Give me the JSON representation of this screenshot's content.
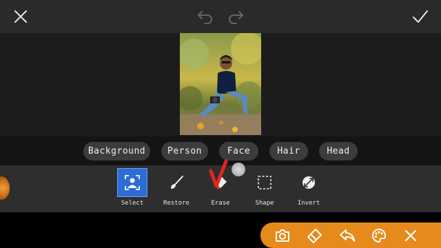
{
  "topbar": {
    "close_icon": "close-icon",
    "undo_icon": "undo-icon",
    "redo_icon": "redo-icon",
    "confirm_icon": "check-icon"
  },
  "selection_tabs": [
    {
      "label": "Background"
    },
    {
      "label": "Person"
    },
    {
      "label": "Face"
    },
    {
      "label": "Hair"
    },
    {
      "label": "Head"
    }
  ],
  "tools": [
    {
      "label": "Select",
      "icon": "select-person-icon",
      "active": true
    },
    {
      "label": "Restore",
      "icon": "brush-icon",
      "active": false
    },
    {
      "label": "Erase",
      "icon": "eraser-icon",
      "active": false
    },
    {
      "label": "Shape",
      "icon": "dashed-square-icon",
      "active": false
    },
    {
      "label": "Invert",
      "icon": "invert-icon",
      "active": false
    }
  ],
  "floating_toolbar": {
    "icons": [
      "camera-icon",
      "eraser-icon",
      "reply-icon",
      "palette-icon",
      "close-icon"
    ]
  },
  "colors": {
    "accent_blue": "#2d6bd6",
    "orange": "#e68a1c",
    "annotation_red": "#e52420"
  }
}
